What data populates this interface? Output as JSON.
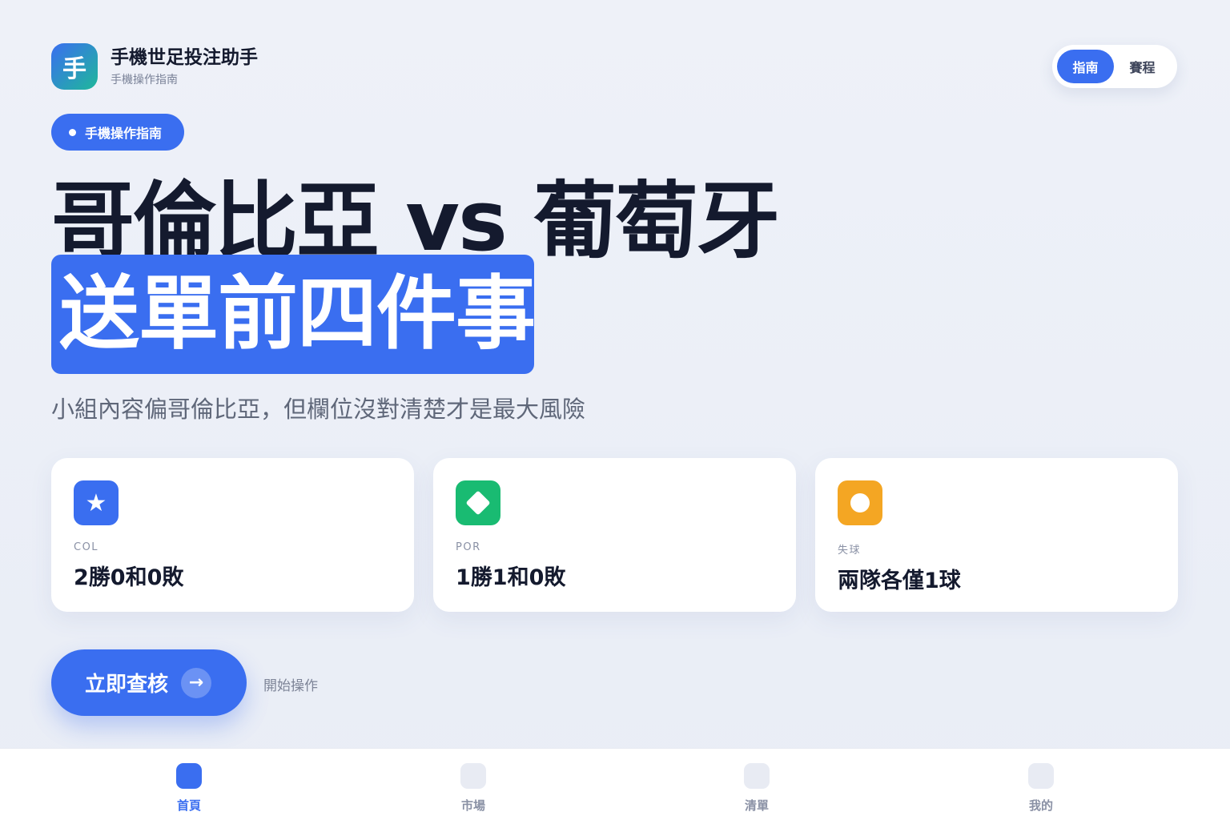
{
  "header": {
    "app_icon_char": "手",
    "title": "手機世足投注助手",
    "subtitle": "手機操作指南"
  },
  "segmented": [
    {
      "label": "指南",
      "active": true
    },
    {
      "label": "賽程",
      "active": false
    }
  ],
  "pill": {
    "label": "手機操作指南"
  },
  "hero": {
    "line1": "哥倫比亞 vs 葡萄牙",
    "line2": "送單前四件事",
    "subtitle": "小組內容偏哥倫比亞，但欄位沒對清楚才是最大風險"
  },
  "cards": [
    {
      "icon": "star-icon",
      "icon_char": "★",
      "color": "#3a6ef0",
      "label": "COL",
      "value": "2勝0和0敗"
    },
    {
      "icon": "diamond-icon",
      "color": "#19bb72",
      "label": "POR",
      "value": "1勝1和0敗"
    },
    {
      "icon": "circle-icon",
      "color": "#f4a623",
      "label": "失球",
      "value": "兩隊各僅1球"
    }
  ],
  "cta": {
    "label": "立即查核",
    "arrow": "→",
    "hint": "開始操作"
  },
  "tabs": [
    {
      "label": "首頁",
      "active": true
    },
    {
      "label": "市場",
      "active": false
    },
    {
      "label": "清單",
      "active": false
    },
    {
      "label": "我的",
      "active": false
    }
  ],
  "colors": {
    "accent": "#3a6ef0",
    "green": "#19bb72",
    "orange": "#f4a623"
  }
}
